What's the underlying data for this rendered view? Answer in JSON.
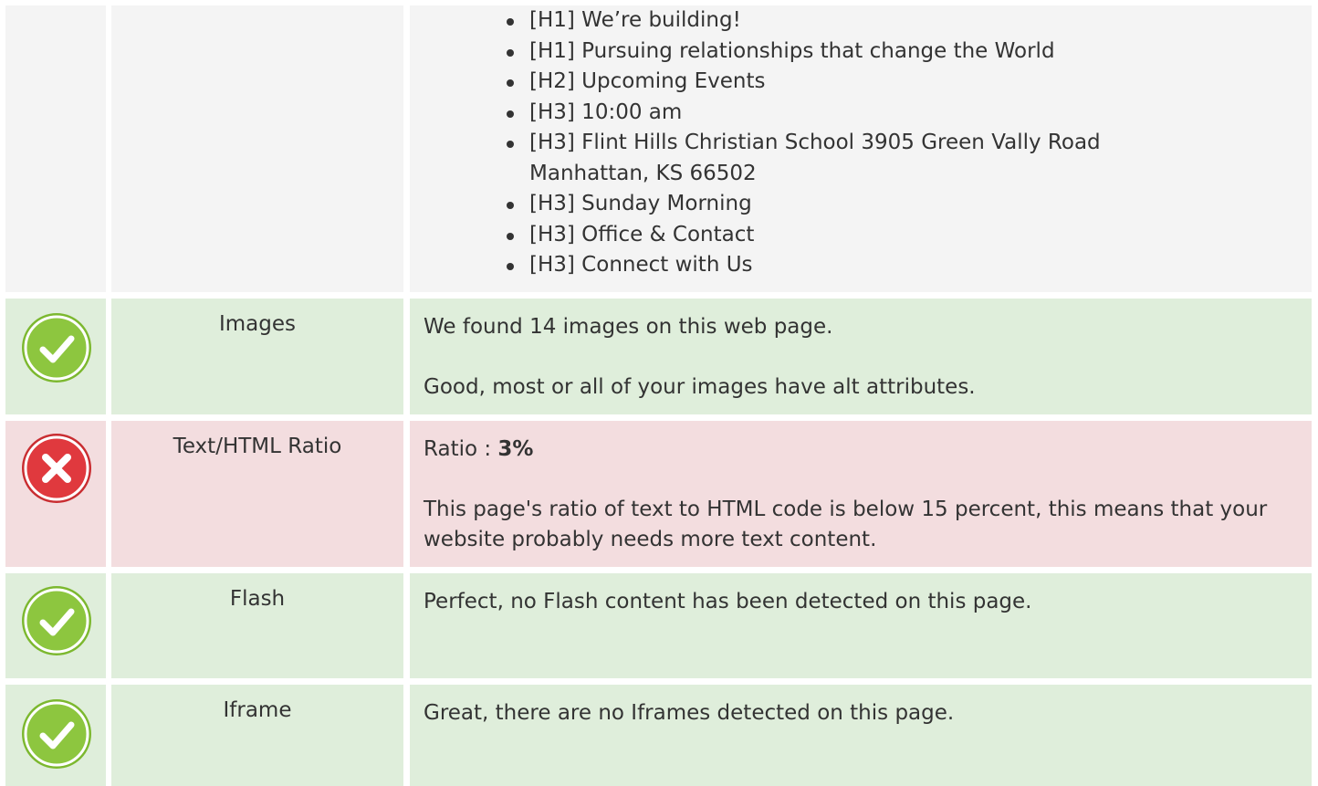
{
  "headings": {
    "items": [
      "[H1] We’re building!",
      "[H1] Pursuing relationships that change the World",
      "[H2] Upcoming Events",
      "[H3] 10:00 am",
      "[H3] Flint Hills Christian School 3905 Green Vally Road Manhattan, KS 66502",
      "[H3] Sunday Morning",
      "[H3] Office & Contact",
      "[H3] Connect with Us"
    ]
  },
  "images": {
    "label": "Images",
    "status": "pass",
    "line1": "We found 14 images on this web page.",
    "line2": "Good, most or all of your images have alt attributes."
  },
  "ratio": {
    "label": "Text/HTML Ratio",
    "status": "fail",
    "prefix": "Ratio : ",
    "value": "3%",
    "line2": "This page's ratio of text to HTML code is below 15 percent, this means that your website probably needs more text content."
  },
  "flash": {
    "label": "Flash",
    "status": "pass",
    "line1": "Perfect, no Flash content has been detected on this page."
  },
  "iframe": {
    "label": "Iframe",
    "status": "pass",
    "line1": "Great, there are no Iframes detected on this page."
  },
  "colors": {
    "pass_bg": "#dfeedb",
    "fail_bg": "#f3dddf",
    "neutral_bg": "#f4f4f4",
    "pass_icon": "#8dc63f",
    "fail_icon": "#e0393e"
  }
}
